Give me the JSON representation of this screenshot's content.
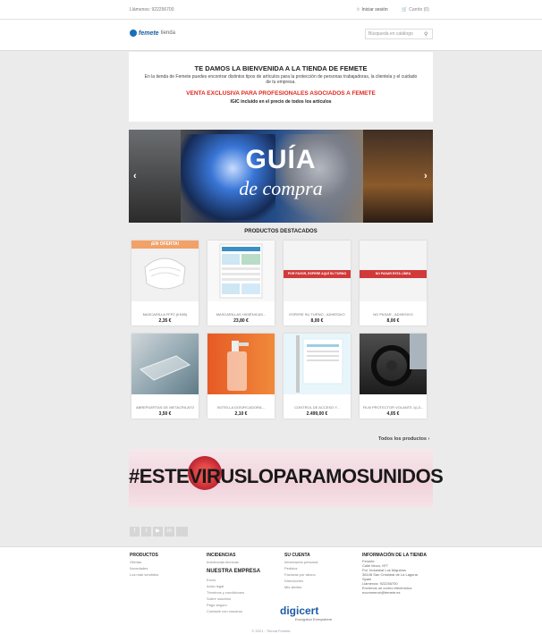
{
  "topbar": {
    "phone": "Llámenos: 922256700",
    "login": "Iniciar sesión",
    "cart": "Carrito (0)"
  },
  "header": {
    "logo_main": "femete",
    "logo_sub": "tienda",
    "search_placeholder": "Búsqueda en catálogo"
  },
  "welcome": {
    "title": "TE DAMOS LA BIENVENIDA A LA TIENDA DE FEMETE",
    "body": "En la tienda de Femete puedes encontrar distintos tipos de artículos para la protección de personas trabajadoras, la clientela y el cuidado de tu empresa.",
    "exclusive": "VENTA EXCLUSIVA PARA PROFESIONALES ASOCIADOS A FEMETE",
    "igic": "IGIC incluido en el precio de todos los artículos"
  },
  "banner": {
    "line1": "GUÍA",
    "line2": "de compra",
    "prev": "‹",
    "next": "›"
  },
  "products_section": {
    "title": "PRODUCTOS DESTACADOS",
    "all_link": "Todos los productos ›"
  },
  "products": [
    {
      "name": "MASCARILLA FFP2 (KN95)",
      "price": "2,35 €",
      "badge": "¡EN OFERTA!"
    },
    {
      "name": "MASCARILLAS HIGIÉNICAS...",
      "price": "23,80 €"
    },
    {
      "name": "ESPERE SU TURNO - ADHESIVO",
      "price": "8,00 €",
      "sign": "POR FAVOR, ESPERE AQUÍ SU TURNO"
    },
    {
      "name": "NO PASAR - ADHESIVO",
      "price": "8,00 €",
      "sign": "NO PASAR ESTA LÍNEA"
    },
    {
      "name": "ABREPUERTAS DE METACRILATO",
      "price": "3,50 €"
    },
    {
      "name": "BOTELLA DOSIFICADORA...",
      "price": "2,10 €"
    },
    {
      "name": "CONTROL DE ACCESO Y...",
      "price": "2.499,00 €"
    },
    {
      "name": "FILM PROTECTOR VOLANTE 1(L3...",
      "price": "4,05 €"
    }
  ],
  "promo": {
    "text": "#ESTEVIRUSLOPARAMOSUNIDOS"
  },
  "social": [
    "f",
    "t",
    "▶",
    "in"
  ],
  "footer": {
    "productos": {
      "title": "PRODUCTOS",
      "items": [
        "Ofertas",
        "Novedades",
        "Los más vendidos"
      ]
    },
    "incidencias": {
      "title": "INCIDENCIAS",
      "items": [
        "Incidencias técnicas"
      ]
    },
    "empresa": {
      "title": "NUESTRA EMPRESA",
      "items": [
        "Envío",
        "Aviso legal",
        "Términos y condiciones",
        "Sobre nosotros",
        "Pago seguro",
        "Contacte con nosotros"
      ]
    },
    "cuenta": {
      "title": "SU CUENTA",
      "items": [
        "Información personal",
        "Pedidos",
        "Facturas por abono",
        "Direcciones",
        "Mis alertas"
      ]
    },
    "tienda": {
      "title": "INFORMACIÓN DE LA TIENDA",
      "lines": [
        "Femete",
        "Calle Mozo, Nº7",
        "Pol. Industrial Los Majuelos",
        "38108 San Cristóbal de La Laguna",
        "Spain",
        "Llámenos: 922256700",
        "Envíenos un correo electrónico:",
        "ecommerce@femete.es"
      ]
    },
    "digicert": "digicert",
    "digicert_sub": "Encryption Everywhere",
    "copyright": "© 2021 - Tienda Femete"
  },
  "colors": {
    "accent": "#e0261f",
    "brand": "#1b5fa5",
    "offer": "#f2a167"
  }
}
